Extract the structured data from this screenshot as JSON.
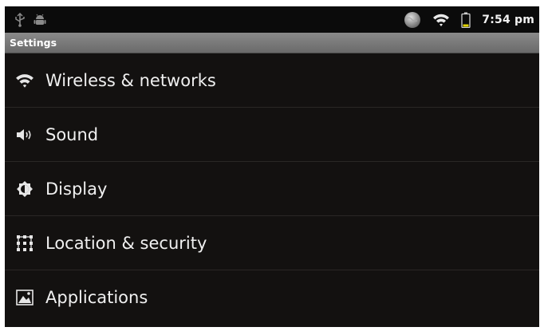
{
  "status_bar": {
    "time": "7:54 pm",
    "icons": [
      "usb-icon",
      "android-debug-icon",
      "sync-globe-icon",
      "wifi-signal-icon",
      "battery-icon"
    ]
  },
  "header": {
    "title": "Settings"
  },
  "settings": {
    "items": [
      {
        "label": "Wireless & networks",
        "icon": "wifi-icon"
      },
      {
        "label": "Sound",
        "icon": "speaker-icon"
      },
      {
        "label": "Display",
        "icon": "brightness-icon"
      },
      {
        "label": "Location & security",
        "icon": "grid-lock-icon"
      },
      {
        "label": "Applications",
        "icon": "applications-icon"
      }
    ]
  },
  "colors": {
    "background": "#131110",
    "status_bar": "#0b0b0b",
    "title_bar": "#7a7a7a",
    "text": "#f0f0f0",
    "battery_accent": "#e3d400"
  }
}
